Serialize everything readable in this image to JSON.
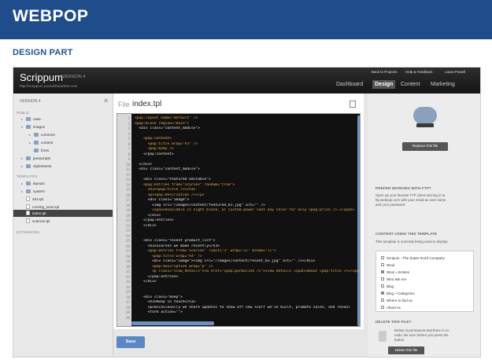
{
  "banner": {
    "title": "WEBPOP"
  },
  "section_title": "DESIGN PART",
  "app": {
    "brand": "Scrippum",
    "version": "VERSION 4",
    "url": "http://scrippum.yourwebtoonline.com",
    "top_links": [
      "Back to Projects",
      "Help & Feedback",
      "Laura Powell"
    ],
    "nav": [
      "Dashboard",
      "Design",
      "Content",
      "Marketing"
    ]
  },
  "sidebar": {
    "version_select": "VERSION 4",
    "sections": [
      "PUBLIC",
      "TEMPLATES",
      "EXTENSIONS"
    ],
    "public_items": [
      "case",
      "images",
      "common",
      "content",
      "fonts",
      "javascripts",
      "stylesheets"
    ],
    "template_items": [
      "layouts",
      "system",
      "404.tpl",
      "coming_soon.tpl",
      "index.tpl",
      "scarves.tpl"
    ]
  },
  "editor": {
    "file_label": "File",
    "file_name": "index.tpl",
    "line_numbers": [
      "1",
      "2",
      "3",
      "4",
      "5",
      "6",
      "7",
      "8",
      "9",
      "10",
      "11",
      "12",
      "13",
      "14",
      "15",
      "16",
      "17",
      "18",
      "19",
      "20",
      "21",
      "22",
      "23",
      "24",
      "25",
      "26",
      "27",
      "28",
      "29",
      "30",
      "31",
      "32",
      "33",
      "34",
      "35",
      "36",
      "37",
      "38",
      "39",
      "40"
    ],
    "lines": [
      "<pop:layout name=\"default\" />",
      "<pop:block region=\"main\">",
      "  <div class=\"content_module\">",
      "",
      "    <pop:content>",
      "      <pop:title wrap=\"h3\" />",
      "      <pop:body />",
      "    </pop:content>",
      "",
      "  </div>",
      "  <div class=\"content_module\">",
      "",
      "    <div class=\"featured editable\">",
      "    <pop:entries from=\"scarves\" random=\"true\">",
      "      <h3><pop:title /></h3>",
      "      <p><pop:description /></p>",
      "      <div class=\"image\">",
      "        <img src=\"/images/content/featured_01.jpg\" alt=\"\" />",
      "        <span>Available in night black, or custom power coat any color for only <pop:price />.</span>",
      "      </div>",
      "    </pop:entries>",
      "    </div>",
      "",
      "",
      "    <div class=\"recent product_list\">",
      "      <h3>Scarves we made recently</h3>",
      "      <pop:entries from=\"scarves\" limit=\"3\" wrap=\"ul\" break=\"li\">",
      "        <pop:title wrap=\"h4\" />",
      "        <div class=\"image\"><img src=\"/images/content/recent_01.jpg\" alt=\"\" /></div>",
      "        <pop:description wrap=\"p\" />",
      "        <p class=\"view_details\"><a href=\"<pop:permalink />\">view details <span>about <pop:title /></span></a></p>",
      "      </pop:entries>",
      "    </div>",
      "",
      "",
      "    <div class=\"keep\">",
      "      <h3>Keep in touch</h3>",
      "      <p>Occasionally we share updates to show off new scarf we've built, promote sales, and reveal",
      "      <form action=\"\">",
      ""
    ],
    "save_label": "Save"
  },
  "right_panel": {
    "replace_button": "Replace this file",
    "ftp_heading": "PREFER WORKING WITH FTP?",
    "ftp_text": [
      "Open up your favorite FTP client and log in to",
      "ftp.webpop.com with your email as user name",
      "and your password."
    ],
    "using_heading": "CONTENT USING THIS TEMPLATE",
    "using_text": "This template is currently being used to display:",
    "template_list": [
      {
        "label": "Scripum - The Super Scarf Company",
        "checked": false
      },
      {
        "label": "Wool",
        "checked": false
      },
      {
        "label": "Wool » Entries",
        "checked": true
      },
      {
        "label": "Who We Are",
        "checked": false
      },
      {
        "label": "Blog",
        "checked": false
      },
      {
        "label": "Blog » Categories",
        "checked": true
      },
      {
        "label": "Where to find us",
        "checked": false
      },
      {
        "label": "About us",
        "checked": false
      }
    ],
    "delete_heading": "DELETE THIS FILE?",
    "delete_text": [
      "Delete is permanent and there is no",
      "undo. Be sure before you press the",
      "button."
    ],
    "delete_button": "Delete this file"
  }
}
